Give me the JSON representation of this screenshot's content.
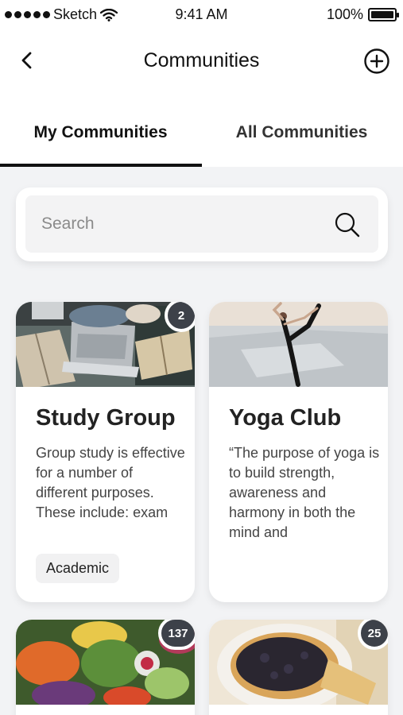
{
  "status_bar": {
    "carrier": "Sketch",
    "time": "9:41 AM",
    "battery": "100%"
  },
  "nav": {
    "title": "Communities"
  },
  "tabs": [
    {
      "label": "My Communities"
    },
    {
      "label": "All Communities"
    }
  ],
  "search": {
    "placeholder": "Search",
    "value": ""
  },
  "communities": [
    {
      "title": "Study Group",
      "description": "Group study is effective for a number of different purposes. These include: exam",
      "tag": "Academic",
      "count": "2"
    },
    {
      "title": "Yoga Club",
      "description": "“The purpose of yoga is to build strength, awareness and harmony in both the mind and",
      "tag": "",
      "count": ""
    },
    {
      "title": "",
      "description": "",
      "tag": "",
      "count": "137"
    },
    {
      "title": "",
      "description": "",
      "tag": "",
      "count": "25"
    }
  ],
  "colors": {
    "badge": "#3d4149",
    "background": "#f2f3f5",
    "accent": "#111111"
  }
}
